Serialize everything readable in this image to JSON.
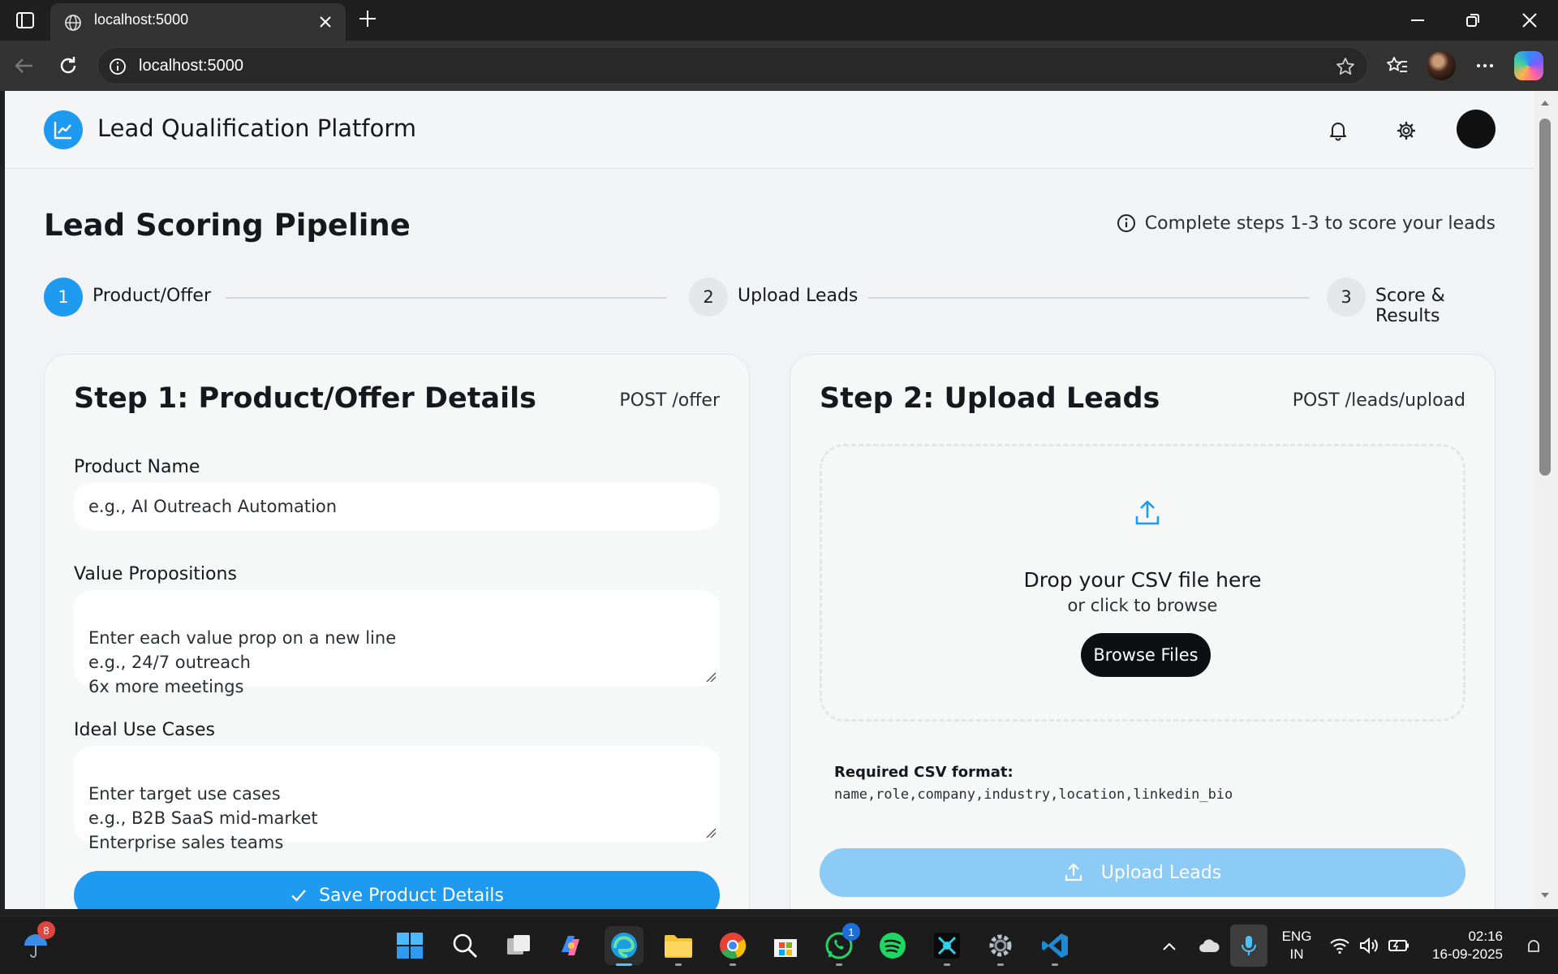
{
  "browser": {
    "tab_title": "localhost:5000",
    "url": "localhost:5000"
  },
  "app": {
    "title": "Lead Qualification Platform",
    "accent_color": "#1e9af0"
  },
  "page": {
    "title": "Lead Scoring Pipeline",
    "hint": "Complete steps 1-3 to score your leads"
  },
  "steps": [
    {
      "number": "1",
      "label": "Product/Offer"
    },
    {
      "number": "2",
      "label": "Upload Leads"
    },
    {
      "number": "3",
      "label": "Score & Results"
    }
  ],
  "step1": {
    "title": "Step 1: Product/Offer Details",
    "endpoint": "POST /offer",
    "product_name_label": "Product Name",
    "product_name_placeholder": "e.g., AI Outreach Automation",
    "value_props_label": "Value Propositions",
    "value_props_placeholder": "Enter each value prop on a new line\ne.g., 24/7 outreach\n6x more meetings",
    "use_cases_label": "Ideal Use Cases",
    "use_cases_placeholder": "Enter target use cases\ne.g., B2B SaaS mid-market\nEnterprise sales teams",
    "save_button": "Save Product Details"
  },
  "step2": {
    "title": "Step 2: Upload Leads",
    "endpoint": "POST /leads/upload",
    "drop_main": "Drop your CSV file here",
    "drop_sub": "or click to browse",
    "browse_button": "Browse Files",
    "csv_label": "Required CSV format:",
    "csv_format": "name,role,company,industry,location,linkedin_bio",
    "upload_button": "Upload Leads"
  },
  "taskbar": {
    "weather_badge": "8",
    "whatsapp_badge": "1",
    "language_line1": "ENG",
    "language_line2": "IN",
    "time": "02:16",
    "date": "16-09-2025"
  }
}
